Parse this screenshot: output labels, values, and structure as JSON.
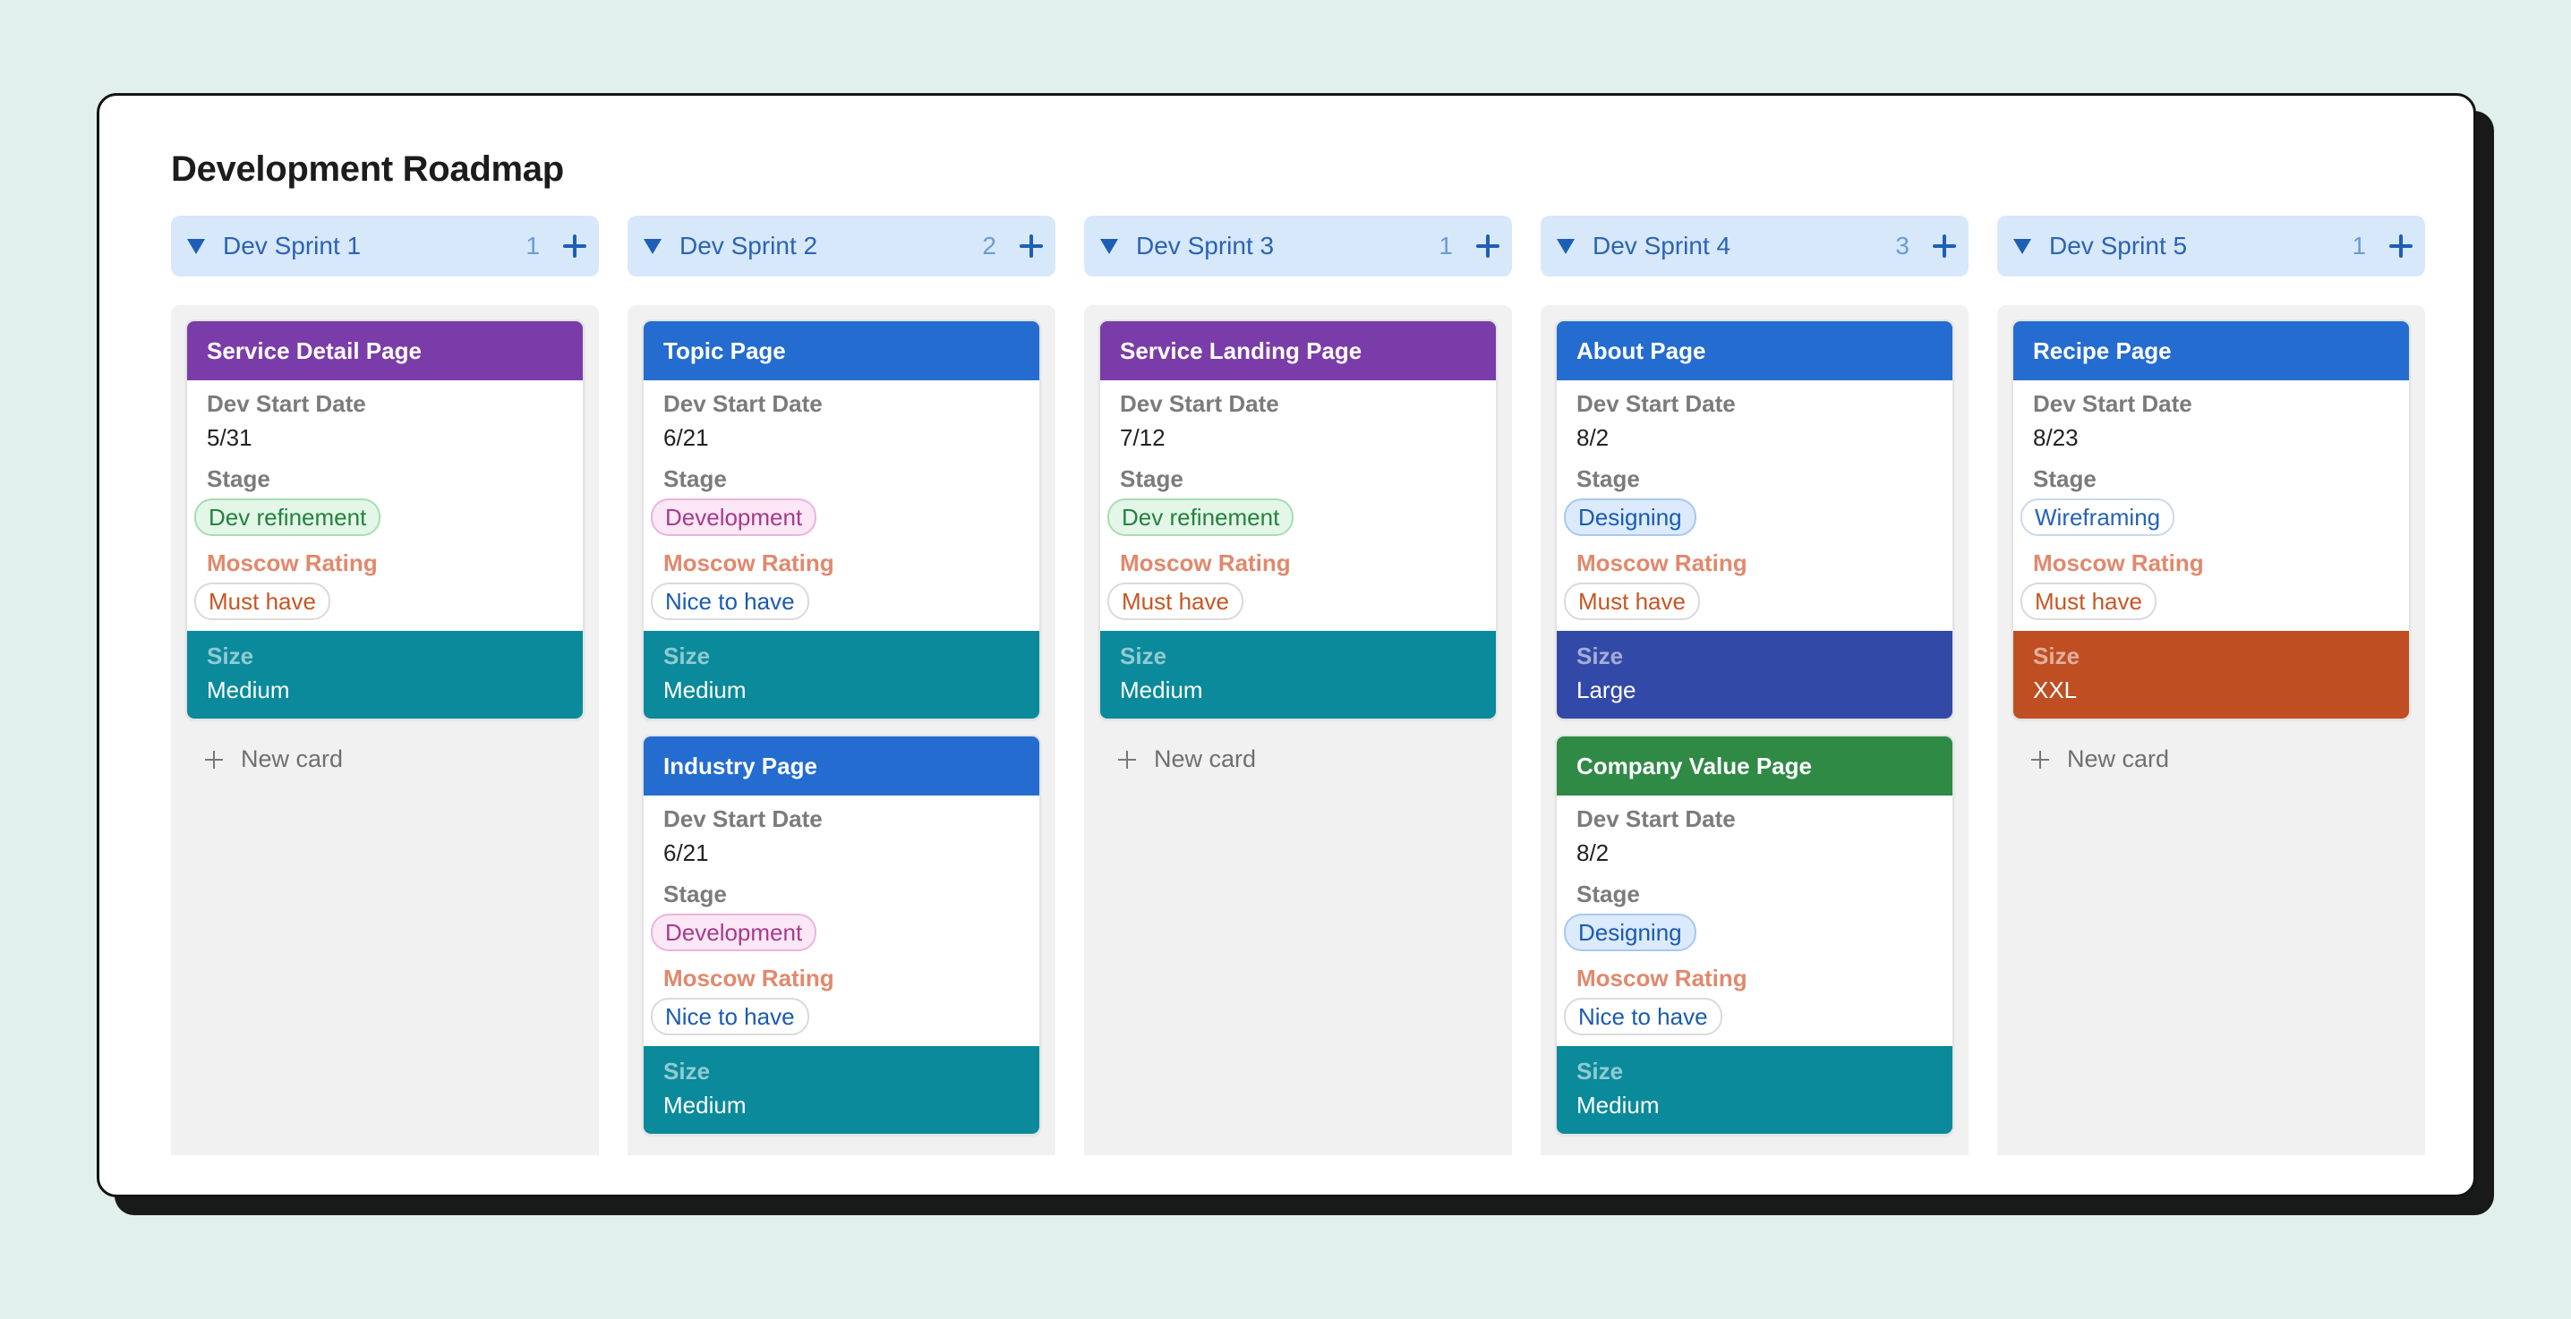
{
  "board": {
    "title": "Development Roadmap",
    "field_labels": {
      "dev_start": "Dev Start Date",
      "stage": "Stage",
      "moscow": "Moscow Rating",
      "size": "Size"
    },
    "new_card_label": "New card",
    "columns": [
      {
        "name": "Dev Sprint 1",
        "count": "1",
        "cards": [
          {
            "title": "Service Detail Page",
            "title_color": "#7a3ca8",
            "dev_start": "5/31",
            "stage": "Dev refinement",
            "stage_style": "dev-ref",
            "moscow": "Must have",
            "moscow_style": "must",
            "size": "Medium",
            "size_color": "#0a8a9b"
          }
        ],
        "show_new_card": true
      },
      {
        "name": "Dev Sprint 2",
        "count": "2",
        "cards": [
          {
            "title": "Topic Page",
            "title_color": "#246ccf",
            "dev_start": "6/21",
            "stage": "Development",
            "stage_style": "development",
            "moscow": "Nice to have",
            "moscow_style": "nice",
            "size": "Medium",
            "size_color": "#0a8a9b"
          },
          {
            "title": "Industry Page",
            "title_color": "#246ccf",
            "dev_start": "6/21",
            "stage": "Development",
            "stage_style": "development",
            "moscow": "Nice to have",
            "moscow_style": "nice",
            "size": "Medium",
            "size_color": "#0a8a9b"
          }
        ],
        "show_new_card": false
      },
      {
        "name": "Dev Sprint 3",
        "count": "1",
        "cards": [
          {
            "title": "Service Landing Page",
            "title_color": "#7a3ca8",
            "dev_start": "7/12",
            "stage": "Dev refinement",
            "stage_style": "dev-ref",
            "moscow": "Must have",
            "moscow_style": "must",
            "size": "Medium",
            "size_color": "#0a8a9b"
          }
        ],
        "show_new_card": true
      },
      {
        "name": "Dev Sprint 4",
        "count": "3",
        "cards": [
          {
            "title": "About Page",
            "title_color": "#246ccf",
            "dev_start": "8/2",
            "stage": "Designing",
            "stage_style": "designing",
            "moscow": "Must have",
            "moscow_style": "must",
            "size": "Large",
            "size_color": "#3349a7"
          },
          {
            "title": "Company Value Page",
            "title_color": "#2f8a45",
            "dev_start": "8/2",
            "stage": "Designing",
            "stage_style": "designing",
            "moscow": "Nice to have",
            "moscow_style": "nice",
            "size": "Medium",
            "size_color": "#0a8a9b"
          }
        ],
        "show_new_card": false
      },
      {
        "name": "Dev Sprint 5",
        "count": "1",
        "cards": [
          {
            "title": "Recipe Page",
            "title_color": "#246ccf",
            "dev_start": "8/23",
            "stage": "Wireframing",
            "stage_style": "wireframing",
            "moscow": "Must have",
            "moscow_style": "must",
            "size": "XXL",
            "size_color": "#bf4e22"
          }
        ],
        "show_new_card": true
      }
    ]
  }
}
